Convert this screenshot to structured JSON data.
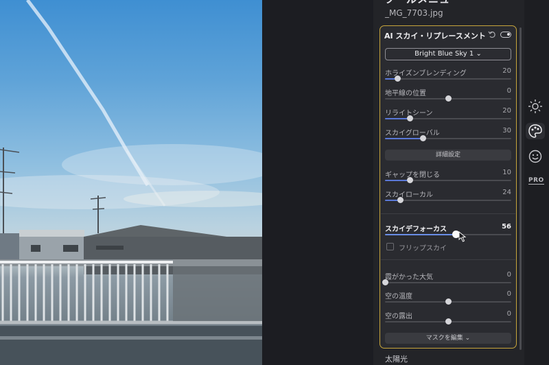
{
  "panel": {
    "heading": "ツールメニュー",
    "filename": "_MG_7703.jpg",
    "bottom_label": "太陽光"
  },
  "tool": {
    "title": "AI スカイ・リプレースメント",
    "preset": "Bright Blue Sky 1",
    "sliders": [
      {
        "label": "ホライズンブレンディング",
        "value": 20,
        "level": 0.1
      },
      {
        "label": "地平線の位置",
        "value": 0,
        "level": 0.5
      },
      {
        "label": "リライトシーン",
        "value": 20,
        "level": 0.2
      },
      {
        "label": "スカイグローバル",
        "value": 30,
        "level": 0.3
      }
    ],
    "advanced_button": "詳細設定",
    "advanced_sliders": [
      {
        "label": "ギャップを閉じる",
        "value": 10,
        "level": 0.2
      },
      {
        "label": "スカイローカル",
        "value": 24,
        "level": 0.12
      }
    ],
    "focus_slider": {
      "label": "スカイデフォーカス",
      "value": 56,
      "level": 0.56
    },
    "flip_label": "フリップスカイ",
    "flip_checked": false,
    "lower_sliders": [
      {
        "label": "霞がかった大気",
        "value": 0,
        "level": 0.0
      },
      {
        "label": "空の温度",
        "value": 0,
        "level": 0.5
      },
      {
        "label": "空の露出",
        "value": 0,
        "level": 0.5
      }
    ],
    "mask_button": "マスクを編集"
  },
  "rail": {
    "icons": [
      "sun-icon",
      "palette-icon",
      "face-icon"
    ],
    "pro_label": "PRO",
    "active": "palette-icon"
  },
  "colors": {
    "accent_border": "#c8a63c",
    "slider_fill": "#5a78d6"
  }
}
